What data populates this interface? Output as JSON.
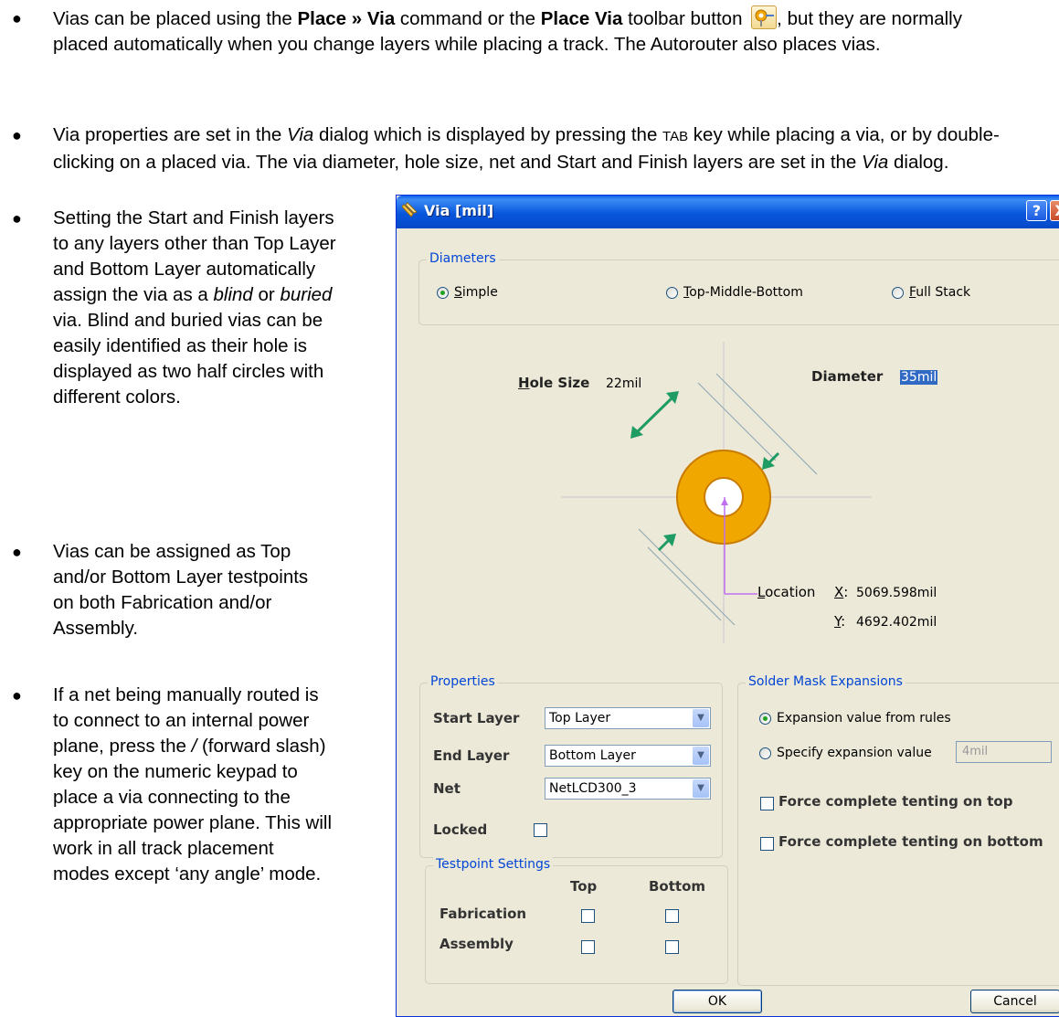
{
  "document": {
    "bullets": [
      {
        "parts": [
          {
            "t": "Vias can be placed using the "
          },
          {
            "t": "Place » Via",
            "s": "b"
          },
          {
            "t": " command or the "
          },
          {
            "t": "Place Via",
            "s": "b"
          },
          {
            "t": " toolbar button "
          },
          {
            "icon": "place-via-toolbar-icon"
          },
          {
            "t": ", but they are normally placed automatically when you change layers while placing a track. The Autorouter also places vias."
          }
        ]
      },
      {
        "parts": [
          {
            "t": "Via properties are set in the "
          },
          {
            "t": "Via",
            "s": "i"
          },
          {
            "t": " dialog which is displayed by pressing the "
          },
          {
            "t": "TAB",
            "s": "sc"
          },
          {
            "t": " key while placing a via, or by double-clicking on a placed via. The via diameter, hole size, net and Start and Finish layers are set in the "
          },
          {
            "t": "Via",
            "s": "i"
          },
          {
            "t": " dialog."
          }
        ]
      },
      {
        "parts": [
          {
            "t": "Setting the Start and Finish layers to any layers other than Top Layer and Bottom Layer automatically assign the via as a "
          },
          {
            "t": "blind",
            "s": "i"
          },
          {
            "t": " or "
          },
          {
            "t": "buried",
            "s": "i"
          },
          {
            "t": " via. Blind and buried vias can be easily identified as their hole is displayed as two half circles with different colors."
          }
        ]
      },
      {
        "parts": [
          {
            "t": "Vias can be assigned as Top and/or Bottom Layer testpoints on both Fabrication and/or Assembly."
          }
        ]
      },
      {
        "parts": [
          {
            "t": "If a net being manually routed is to connect to an internal power plane, press the "
          },
          {
            "t": "/",
            "s": "i"
          },
          {
            "t": " (forward slash) key on the numeric keypad to place a via connecting to the appropriate power plane. This will work in all track placement modes except ‘any angle’ mode."
          }
        ]
      }
    ]
  },
  "dialog": {
    "title": "Via [mil]",
    "help_glyph": "?",
    "close_glyph": "X",
    "diameters": {
      "label": "Diameters",
      "options": [
        {
          "key": "S",
          "rest": "imple",
          "selected": true
        },
        {
          "key": "T",
          "rest": "op-Middle-Bottom",
          "selected": false
        },
        {
          "key": "F",
          "rest": "ull Stack",
          "selected": false
        }
      ]
    },
    "graphic": {
      "hole_size_label_key": "H",
      "hole_size_label_rest": "ole Size",
      "hole_size_value": "22mil",
      "diameter_label": "Diameter",
      "diameter_value": "35mil",
      "location_label_key": "L",
      "location_label_rest": "ocation",
      "x_label_key": "X",
      "x_value": "5069.598mil",
      "y_label_key": "Y",
      "y_value": "4692.402mil",
      "ring_color": "#f0a800",
      "crosshair_color": "#c8c8c8",
      "arrow_color": "#1f9c63",
      "location_line_color": "#c070f0"
    },
    "properties": {
      "label": "Properties",
      "start_layer_label": "Start Layer",
      "start_layer_value": "Top Layer",
      "end_layer_label": "End Layer",
      "end_layer_value": "Bottom Layer",
      "net_label": "Net",
      "net_value": "NetLCD300_3",
      "locked_label": "Locked",
      "locked": false
    },
    "testpoint": {
      "label": "Testpoint Settings",
      "col_top": "Top",
      "col_bottom": "Bottom",
      "row_fabrication": "Fabrication",
      "row_assembly": "Assembly",
      "fabrication_top": false,
      "fabrication_bottom": false,
      "assembly_top": false,
      "assembly_bottom": false
    },
    "solder_mask": {
      "label": "Solder Mask Expansions",
      "option_rules": "Expansion value from rules",
      "option_specify": "Specify expansion value",
      "rules_selected": true,
      "expansion_value": "4mil",
      "tent_top": "Force complete tenting on top",
      "tent_bottom": "Force complete tenting on bottom",
      "tent_top_checked": false,
      "tent_bottom_checked": false
    },
    "buttons": {
      "ok": "OK",
      "cancel": "Cancel"
    }
  }
}
